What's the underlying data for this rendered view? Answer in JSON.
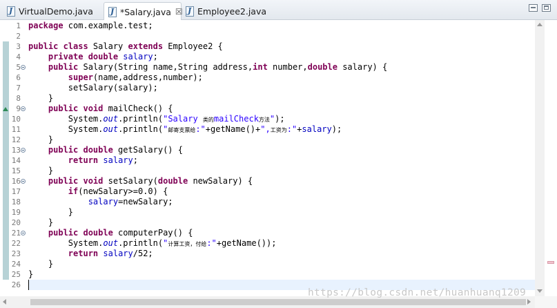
{
  "tabs": [
    {
      "label": "VirtualDemo.java",
      "active": false
    },
    {
      "label": "*Salary.java",
      "active": true,
      "close": "☒"
    },
    {
      "label": "Employee2.java",
      "active": false
    }
  ],
  "icons": {
    "tab_file": "java-file-icon",
    "close": "close-icon",
    "minimize": "minimize-icon",
    "maximize": "maximize-icon",
    "fold": "fold-collapse-icon",
    "override": "override-indicator-icon"
  },
  "editor": {
    "line_numbers": [
      "1",
      "2",
      "3",
      "4",
      "5",
      "6",
      "7",
      "8",
      "9",
      "10",
      "11",
      "12",
      "13",
      "14",
      "15",
      "16",
      "17",
      "18",
      "19",
      "20",
      "21",
      "22",
      "23",
      "24",
      "25",
      "26"
    ],
    "folded_lines": [
      "5",
      "9",
      "13",
      "16",
      "21"
    ],
    "current_line": "26",
    "lines": [
      [
        [
          "kw",
          "package"
        ],
        [
          "p",
          " com.example.test;"
        ]
      ],
      [],
      [
        [
          "kw",
          "public class"
        ],
        [
          "p",
          " Salary "
        ],
        [
          "kw",
          "extends"
        ],
        [
          "p",
          " Employee2 {"
        ]
      ],
      [
        [
          "p",
          "    "
        ],
        [
          "kw",
          "private double"
        ],
        [
          "p",
          " "
        ],
        [
          "fld",
          "salary"
        ],
        [
          "p",
          ";"
        ]
      ],
      [
        [
          "p",
          "    "
        ],
        [
          "kw",
          "public"
        ],
        [
          "p",
          " Salary(String name,String address,"
        ],
        [
          "kw",
          "int"
        ],
        [
          "p",
          " number,"
        ],
        [
          "kw",
          "double"
        ],
        [
          "p",
          " salary) {"
        ]
      ],
      [
        [
          "p",
          "        "
        ],
        [
          "kw",
          "super"
        ],
        [
          "p",
          "(name,address,number);"
        ]
      ],
      [
        [
          "p",
          "        setSalary(salary);"
        ]
      ],
      [
        [
          "p",
          "    }"
        ]
      ],
      [
        [
          "p",
          "    "
        ],
        [
          "kw",
          "public void"
        ],
        [
          "p",
          " mailCheck() {"
        ]
      ],
      [
        [
          "p",
          "        System."
        ],
        [
          "stat",
          "out"
        ],
        [
          "p",
          ".println("
        ],
        [
          "str",
          "\"Salary "
        ],
        [
          "cjk",
          "类的"
        ],
        [
          "str",
          "mailCheck"
        ],
        [
          "cjk",
          "方法"
        ],
        [
          "str",
          "\""
        ],
        [
          "p",
          ");"
        ]
      ],
      [
        [
          "p",
          "        System."
        ],
        [
          "stat",
          "out"
        ],
        [
          "p",
          ".println("
        ],
        [
          "str",
          "\""
        ],
        [
          "cjk",
          "邮寄支票给"
        ],
        [
          "str",
          ":\""
        ],
        [
          "p",
          "+getName()+"
        ],
        [
          "str",
          "\","
        ],
        [
          "cjk",
          "工资为"
        ],
        [
          "str",
          ":\""
        ],
        [
          "p",
          "+"
        ],
        [
          "fld",
          "salary"
        ],
        [
          "p",
          ");"
        ]
      ],
      [
        [
          "p",
          "    }"
        ]
      ],
      [
        [
          "p",
          "    "
        ],
        [
          "kw",
          "public double"
        ],
        [
          "p",
          " getSalary() {"
        ]
      ],
      [
        [
          "p",
          "        "
        ],
        [
          "kw",
          "return"
        ],
        [
          "p",
          " "
        ],
        [
          "fld",
          "salary"
        ],
        [
          "p",
          ";"
        ]
      ],
      [
        [
          "p",
          "    }"
        ]
      ],
      [
        [
          "p",
          "    "
        ],
        [
          "kw",
          "public void"
        ],
        [
          "p",
          " setSalary("
        ],
        [
          "kw",
          "double"
        ],
        [
          "p",
          " newSalary) {"
        ]
      ],
      [
        [
          "p",
          "        "
        ],
        [
          "kw",
          "if"
        ],
        [
          "p",
          "(newSalary>=0.0) {"
        ]
      ],
      [
        [
          "p",
          "            "
        ],
        [
          "fld",
          "salary"
        ],
        [
          "p",
          "=newSalary;"
        ]
      ],
      [
        [
          "p",
          "        }"
        ]
      ],
      [
        [
          "p",
          "    }"
        ]
      ],
      [
        [
          "p",
          "    "
        ],
        [
          "kw",
          "public double"
        ],
        [
          "p",
          " computerPay() {"
        ]
      ],
      [
        [
          "p",
          "        System."
        ],
        [
          "stat",
          "out"
        ],
        [
          "p",
          ".println("
        ],
        [
          "str",
          "\""
        ],
        [
          "cjk",
          "计算工资，付给"
        ],
        [
          "str",
          ":\""
        ],
        [
          "p",
          "+getName());"
        ]
      ],
      [
        [
          "p",
          "        "
        ],
        [
          "kw",
          "return"
        ],
        [
          "p",
          " "
        ],
        [
          "fld",
          "salary"
        ],
        [
          "p",
          "/52;"
        ]
      ],
      [
        [
          "p",
          "    }"
        ]
      ],
      [
        [
          "p",
          "}"
        ]
      ],
      []
    ]
  },
  "watermark": "https://blog.csdn.net/huanhuanq1209",
  "colors": {
    "keyword": "#7f0055",
    "field": "#0000c0",
    "string": "#2a00ff",
    "fold_strip": "#b7d2d6",
    "current_line": "#e8f2fe"
  }
}
